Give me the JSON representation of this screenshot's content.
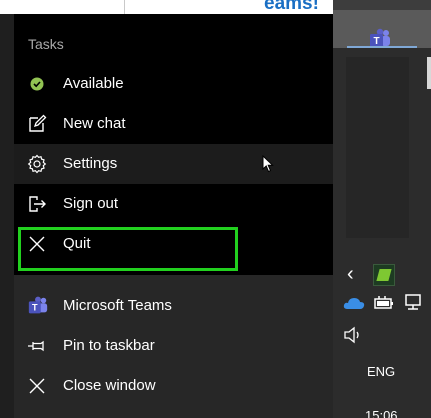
{
  "background": {
    "page_text": "eams!"
  },
  "menu": {
    "header": "Tasks",
    "tasks": [
      {
        "label": "Available",
        "icon": "available-status-icon"
      },
      {
        "label": "New chat",
        "icon": "new-chat-icon"
      },
      {
        "label": "Settings",
        "icon": "gear-icon"
      },
      {
        "label": "Sign out",
        "icon": "sign-out-icon"
      },
      {
        "label": "Quit",
        "icon": "close-icon"
      }
    ],
    "pinned": [
      {
        "label": "Microsoft Teams",
        "icon": "teams-icon"
      },
      {
        "label": "Pin to taskbar",
        "icon": "pin-icon"
      },
      {
        "label": "Close window",
        "icon": "close-icon"
      }
    ]
  },
  "taskbar": {
    "language": "ENG",
    "time": "15:06"
  },
  "colors": {
    "highlight": "#22d11f",
    "available": "#92c353",
    "teams": "#5b5fc7"
  }
}
